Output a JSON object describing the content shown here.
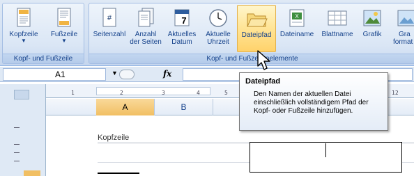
{
  "ribbon": {
    "groups": [
      {
        "label": "Kopf- und Fußzeile",
        "buttons": [
          {
            "label_line1": "Kopfzeile",
            "label_line2": "",
            "icon": "header-page-icon",
            "has_caret": true
          },
          {
            "label_line1": "Fußzeile",
            "label_line2": "",
            "icon": "footer-page-icon",
            "has_caret": true
          }
        ]
      },
      {
        "label": "Kopf- und Fußzeilenelemente",
        "buttons": [
          {
            "label_line1": "Seitenzahl",
            "label_line2": "",
            "icon": "page-number-icon"
          },
          {
            "label_line1": "Anzahl",
            "label_line2": "der Seiten",
            "icon": "page-count-icon"
          },
          {
            "label_line1": "Aktuelles",
            "label_line2": "Datum",
            "icon": "calendar-icon",
            "icon_text": "7"
          },
          {
            "label_line1": "Aktuelle",
            "label_line2": "Uhrzeit",
            "icon": "clock-icon"
          },
          {
            "label_line1": "Dateipfad",
            "label_line2": "",
            "icon": "folder-icon",
            "highlighted": true
          },
          {
            "label_line1": "Dateiname",
            "label_line2": "",
            "icon": "file-name-icon"
          },
          {
            "label_line1": "Blattname",
            "label_line2": "",
            "icon": "sheet-name-icon"
          },
          {
            "label_line1": "Grafik",
            "label_line2": "",
            "icon": "picture-icon"
          },
          {
            "label_line1": "Gra",
            "label_line2": "format",
            "icon": "picture-format-icon"
          }
        ]
      }
    ]
  },
  "formula_bar": {
    "name_box": "A1",
    "fx": "fx"
  },
  "ruler": {
    "ticks": [
      "1",
      "2",
      "3",
      "4",
      "5",
      "12"
    ]
  },
  "columns": [
    "A",
    "B"
  ],
  "selected_column": "A",
  "sheet": {
    "header_label": "Kopfzeile"
  },
  "tooltip": {
    "title": "Dateipfad",
    "body": "Den Namen der aktuellen Datei einschließlich vollständigem Pfad der Kopf- oder Fußzeile hinzufügen."
  },
  "colors": {
    "ribbon_bg": "#dfe9f5",
    "highlight": "#ffd26b",
    "selected_column": "#f1bf63",
    "text_blue": "#15428b"
  }
}
